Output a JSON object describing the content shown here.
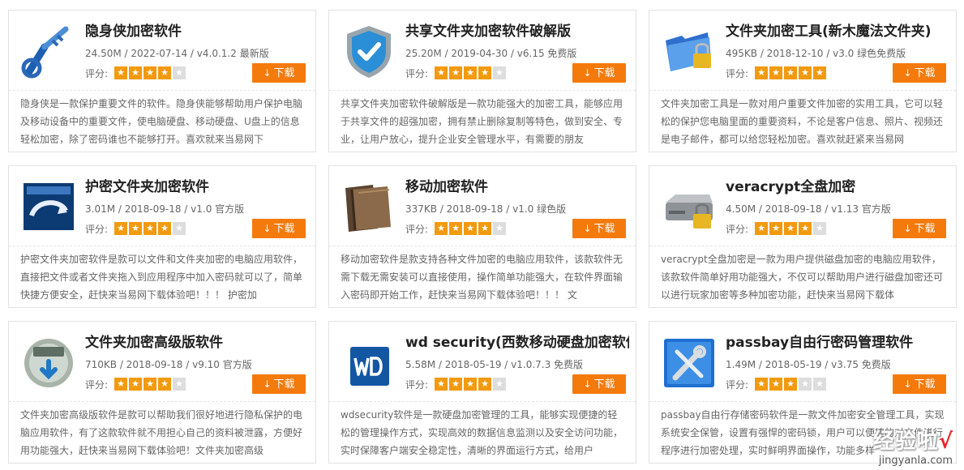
{
  "download_label": "下载",
  "rating_label": "评分:",
  "cards": [
    {
      "title": "隐身侠加密软件",
      "meta": "24.50M / 2022-07-14 / v4.0.1.2 最新版",
      "rating": 4,
      "icon": "blue-key-icon",
      "desc": "隐身侠是一款保护重要文件的软件。隐身侠能够帮助用户保护电脑及移动设备中的重要文件，使电脑硬盘、移动硬盘、U盘上的信息轻松加密，除了密码谁也不能够打开。喜欢就来当易网下"
    },
    {
      "title": "共享文件夹加密软件破解版",
      "meta": "25.20M / 2019-04-30 / v6.15 免费版",
      "rating": 4,
      "icon": "shield-check-icon",
      "desc": "共享文件夹加密软件破解版是一款功能强大的加密工具，能够应用于共享文件的超强加密，拥有禁止删除复制等特色，做到安全、专业，让用户放心，提升企业安全管理水平，有需要的朋友"
    },
    {
      "title": "文件夹加密工具(新木魔法文件夹)",
      "meta": "495KB / 2018-12-10 / v3.0 绿色免费版",
      "rating": 5,
      "icon": "folder-lock-icon",
      "desc": "文件夹加密工具是一款对用户重要文件加密的实用工具，它可以轻松的保护您电脑里面的重要资料，不论是客户信息、照片、视频还是电子邮件，都可以给您轻松加密。喜欢就赶紧来当易网"
    },
    {
      "title": "护密文件夹加密软件",
      "meta": "3.01M / 2018-09-18 / v1.0 官方版",
      "rating": 4,
      "icon": "window-arrow-icon",
      "desc": "护密文件夹加密软件是款可以文件和文件夹加密的电脑应用软件，直接把文件或者文件夹拖入到应用程序中加入密码就可以了，简单快捷方便安全，赶快来当易网下载体验吧！！！ 护密加"
    },
    {
      "title": "移动加密软件",
      "meta": "337KB / 2018-09-18 / v1.0 绿色版",
      "rating": 4,
      "icon": "brown-folder-icon",
      "desc": "移动加密软件是款支持各种文件加密的电脑应用软件，该款软件无需下载无需安装可以直接使用，操作简单功能强大，在软件界面输入密码即开始工作，赶快来当易网下载体验吧！！！ 文"
    },
    {
      "title": "veracrypt全盘加密",
      "meta": "4.50M / 2018-09-18 / v1.13 官方版",
      "rating": 4,
      "icon": "disk-lock-icon",
      "desc": "veracrypt全盘加密是一款为用户提供磁盘加密的电脑应用软件，该款软件简单好用功能强大，不仅可以帮助用户进行磁盘加密还可以进行玩家加密等多种加密功能，赶快来当易网下载体"
    },
    {
      "title": "文件夹加密高级版软件",
      "meta": "710KB / 2018-09-18 / v9.10 官方版",
      "rating": 4,
      "icon": "globe-download-icon",
      "desc": "文件夹加密高级版软件是款可以帮助我们很好地进行隐私保护的电脑应用软件，有了这款软件就不用担心自己的资料被泄露，方便好用功能强大，赶快来当易网下载体验吧！文件夹加密高级"
    },
    {
      "title": "wd security(西数移动硬盘加密软件)",
      "meta": "5.58M / 2018-05-19 / v1.0.7.3 免费版",
      "rating": 4,
      "icon": "wd-logo-icon",
      "desc": "wdsecurity软件是一款硬盘加密管理的工具，能够实现便捷的轻松的管理操作方式，实现高效的数据信息监测以及安全访问功能，实时保障客户端安全稳定性，清晰的界面运行方式，给用户"
    },
    {
      "title": "passbay自由行密码管理软件",
      "meta": "1.49M / 2018-05-19 / v3.75 免费版",
      "rating": 3,
      "icon": "tools-box-icon",
      "desc": "passbay自由行存储密码软件是一款文件加密安全管理工具，实现系统安全保管，设置有强悍的密码锁，用户可以便捷的对文件进行程序进行加密处理，实时鲜明界面操作，功能多样"
    }
  ],
  "watermark": {
    "text": "经验啦",
    "check": "√",
    "url": "jingyanla.com"
  }
}
